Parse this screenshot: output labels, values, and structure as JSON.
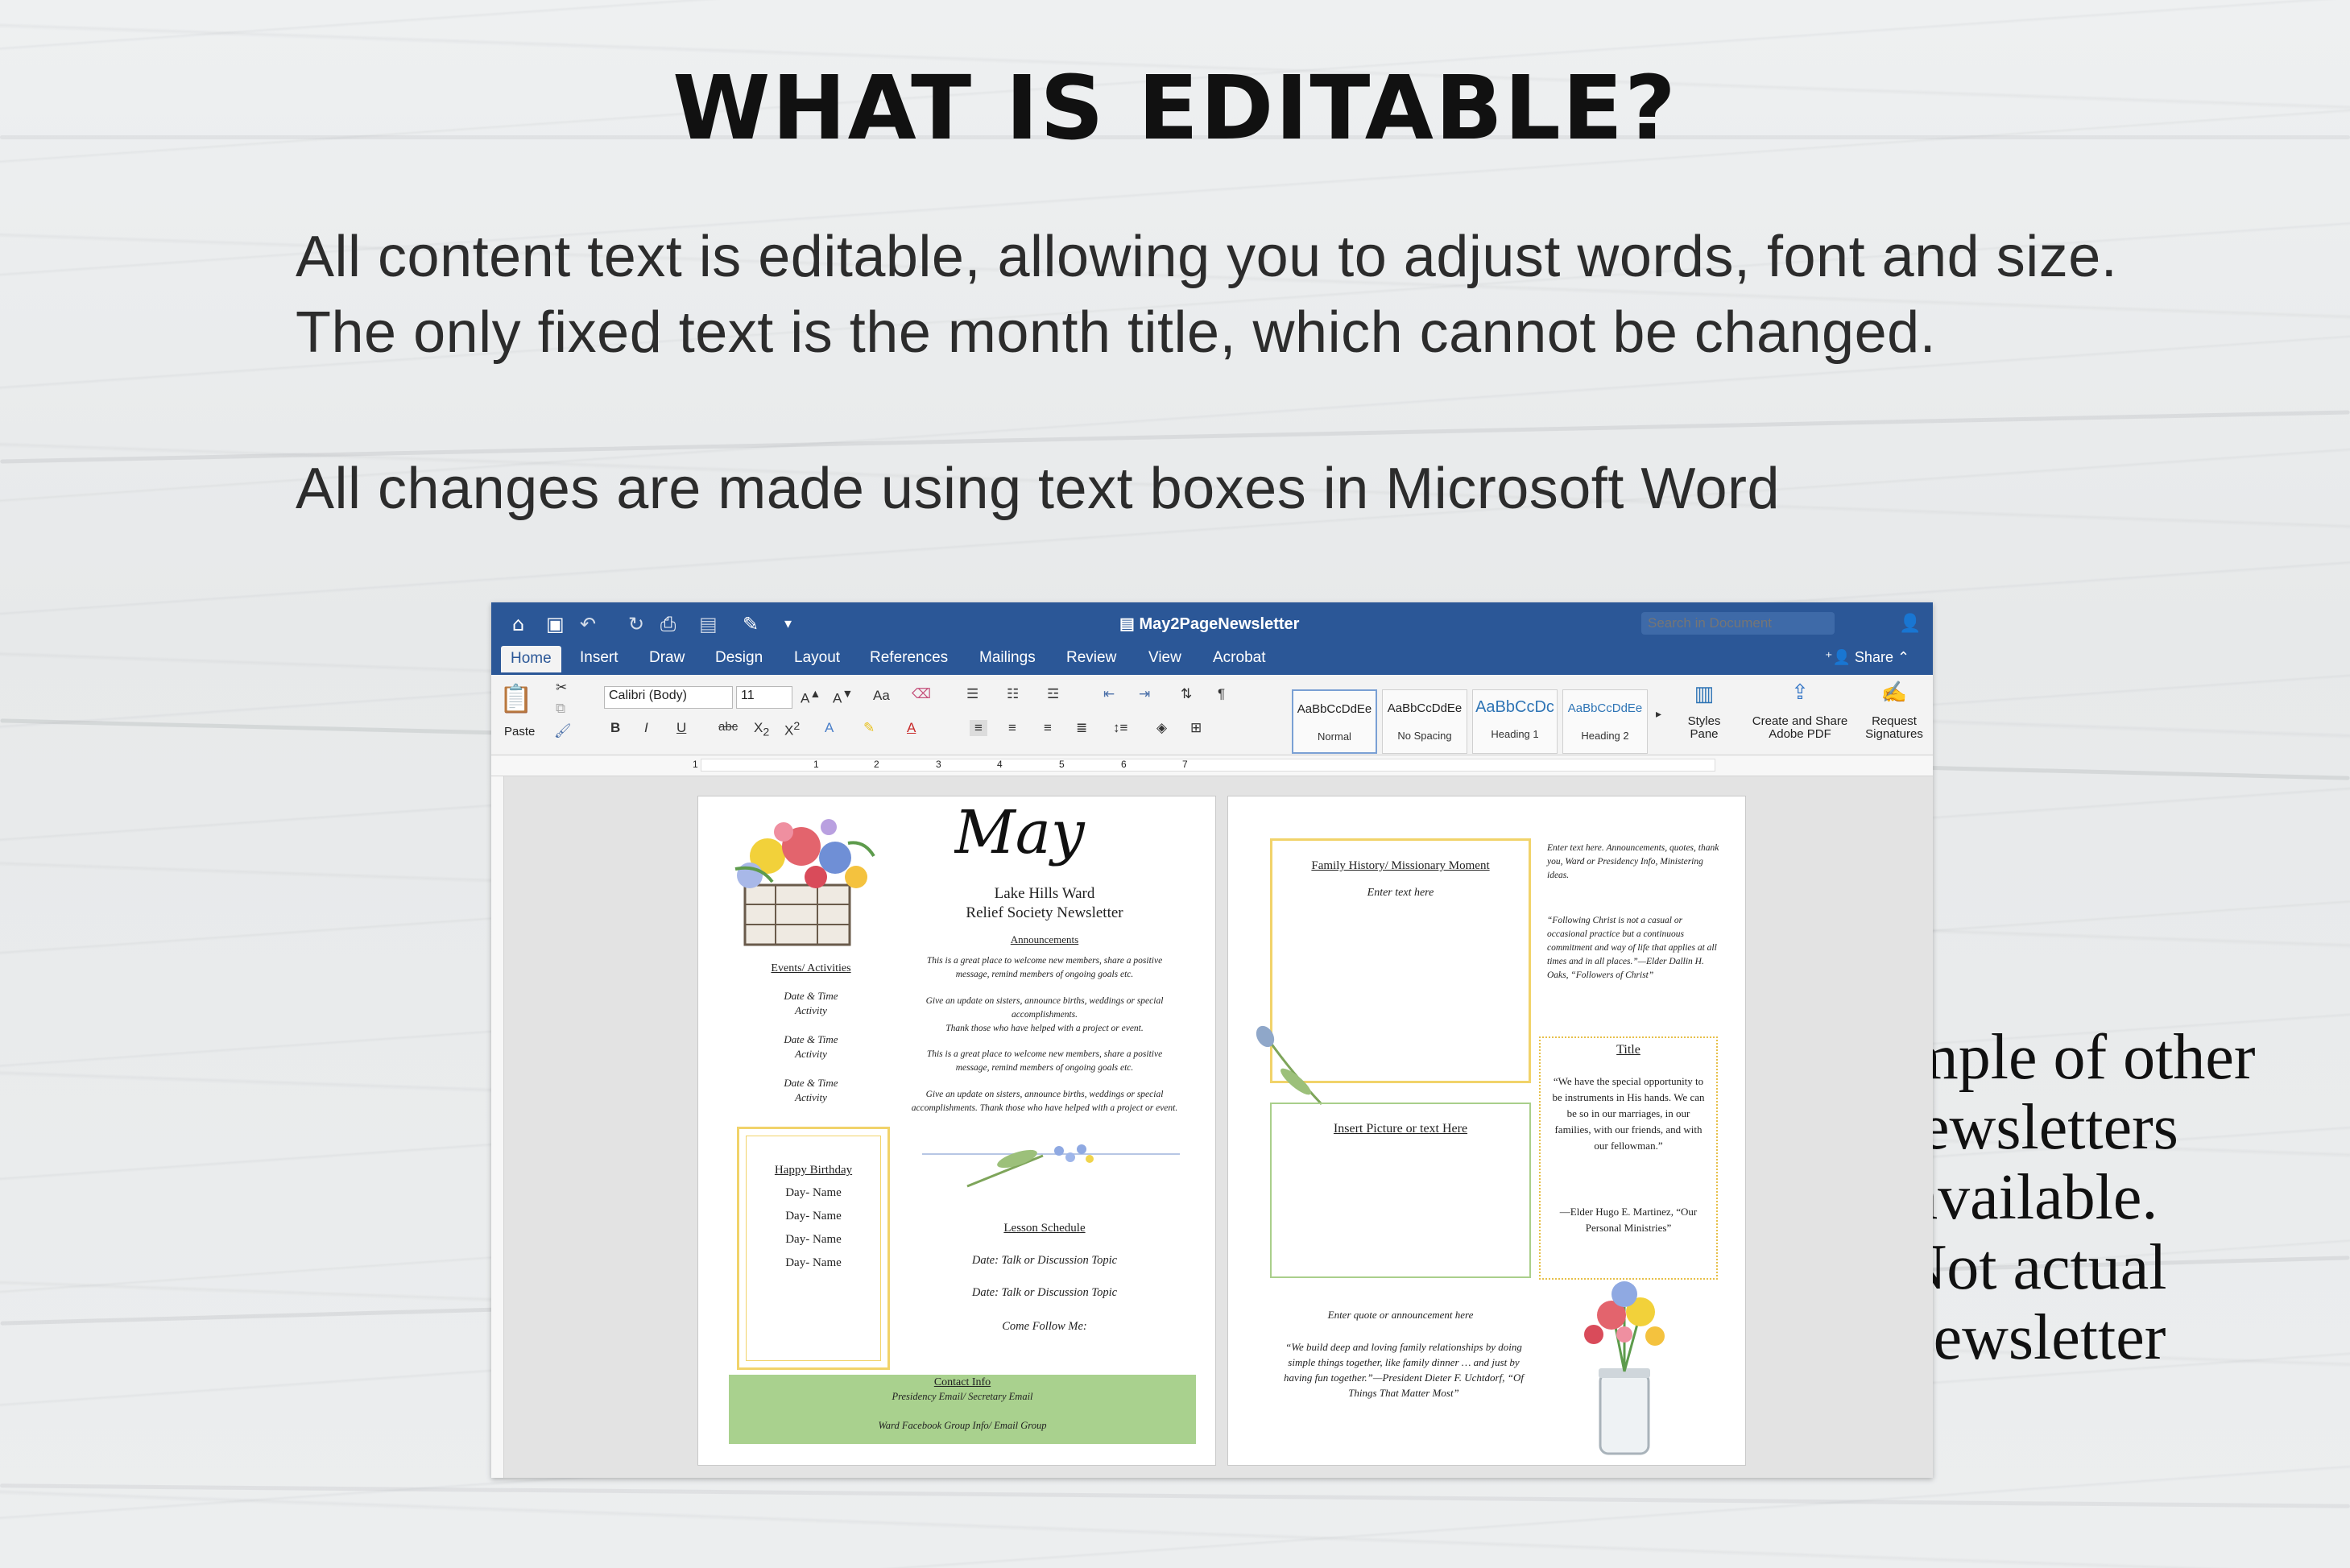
{
  "heading": "WHAT IS EDITABLE?",
  "intro": {
    "line1": "All content text is editable, allowing you to adjust words, font and size.",
    "line2": "The only fixed text is the month title, which cannot be changed.",
    "line3": "All changes are made using text boxes in Microsoft Word"
  },
  "sample_note": [
    "*Sample of other",
    "newsletters",
    "available.",
    "Not actual",
    "newsletter"
  ],
  "word": {
    "doc_title": "May2PageNewsletter",
    "search_placeholder": "Search in Document",
    "share": "Share",
    "tabs": [
      "Home",
      "Insert",
      "Draw",
      "Design",
      "Layout",
      "References",
      "Mailings",
      "Review",
      "View",
      "Acrobat"
    ],
    "paste": "Paste",
    "font_name": "Calibri (Body)",
    "font_size": "11",
    "styles": [
      {
        "preview": "AaBbCcDdEe",
        "name": "Normal"
      },
      {
        "preview": "AaBbCcDdEe",
        "name": "No Spacing"
      },
      {
        "preview": "AaBbCcDc",
        "name": "Heading 1"
      },
      {
        "preview": "AaBbCcDdEe",
        "name": "Heading 2"
      }
    ],
    "styles_pane": "Styles Pane",
    "create_share": "Create and Share Adobe PDF",
    "request_signatures": "Request Signatures",
    "ruler_numbers": [
      "1",
      "1",
      "2",
      "3",
      "4",
      "5",
      "6",
      "7"
    ]
  },
  "page1": {
    "month": "May",
    "ward": "Lake Hills Ward",
    "newsletter": "Relief Society Newsletter",
    "announcements_head": "Announcements",
    "ann1": "This is a great place to welcome new members, share a positive message, remind members of ongoing goals etc.",
    "ann2": "Give an update on sisters, announce births, weddings or special accomplishments.",
    "ann3": "Thank those who have helped with a project or event.",
    "ann4": "This is a great place to welcome new members, share a positive message, remind members of ongoing goals etc.",
    "ann5": "Give an update on sisters, announce births, weddings or special accomplishments. Thank those who have helped with a project or event.",
    "events_head": "Events/ Activities",
    "events": [
      "Date & Time",
      "Activity",
      "Date & Time",
      "Activity",
      "Date & Time",
      "Activity"
    ],
    "birthday_head": "Happy Birthday",
    "birthdays": [
      "Day- Name",
      "Day- Name",
      "Day- Name",
      "Day- Name"
    ],
    "lesson_head": "Lesson Schedule",
    "lessons": [
      "Date: Talk or Discussion Topic",
      "Date: Talk or Discussion Topic",
      "Come Follow Me:"
    ],
    "contact_head": "Contact Info",
    "contact1": "Presidency Email/ Secretary Email",
    "contact2": "Ward Facebook Group Info/ Email Group"
  },
  "page2": {
    "family_head": "Family History/ Missionary Moment",
    "enter_text": "Enter text here",
    "side_text": "Enter text here. Announcements, quotes, thank you, Ward or Presidency Info, Ministering ideas.",
    "oaks_quote": "“Following Christ is not a casual or occasional practice but a continuous commitment and way of life that applies at all times and in all places.”—Elder Dallin H. Oaks, “Followers of Christ”",
    "title": "Title",
    "martinez_quote": "“We have the special opportunity to be instruments in His hands. We can be so in our marriages, in our families, with our friends, and with our fellowman.”",
    "martinez_attr": "—Elder Hugo E. Martinez, “Our Personal Ministries”",
    "insert_picture": "Insert Picture or text  Here",
    "quote_head": "Enter quote or announcement here",
    "uchtdorf_quote": "“We build deep and loving family relationships by doing simple things together, like family dinner … and just by having fun together.”—President Dieter F. Uchtdorf, “Of Things That Matter Most”"
  },
  "colors": {
    "word_blue": "#2b5797",
    "yellow_box": "#f1d36a",
    "green_box": "#a9cf8b",
    "contact_bg": "#a9d18e"
  }
}
